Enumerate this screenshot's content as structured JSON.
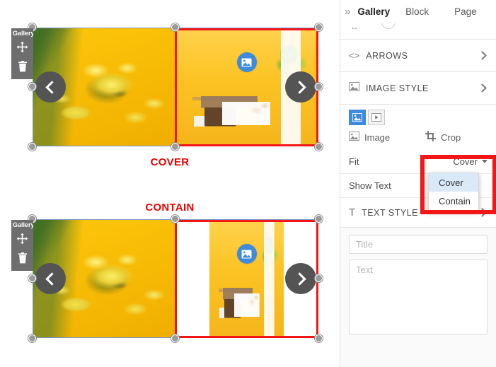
{
  "canvas": {
    "element_toolbar": {
      "title": "Gallery",
      "move_icon": "move-arrows-icon",
      "delete_icon": "trash-icon"
    },
    "galleries": [
      {
        "id": "cover-gallery",
        "caption": "COVER",
        "fit_mode": "cover",
        "slides": [
          {
            "name": "flower-photo",
            "alt": "yellow daffodils on yellow background"
          },
          {
            "name": "room-photo",
            "alt": "girl reclining on bench by yellow wall"
          }
        ],
        "prev_arrow": "chevron-left-icon",
        "next_arrow": "chevron-right-icon",
        "badge_icon": "image-badge-icon"
      },
      {
        "id": "contain-gallery",
        "caption": "CONTAIN",
        "fit_mode": "contain",
        "slides": [
          {
            "name": "flower-photo",
            "alt": "yellow daffodils on yellow background"
          },
          {
            "name": "room-photo",
            "alt": "girl reclining on bench by yellow wall"
          }
        ],
        "prev_arrow": "chevron-left-icon",
        "next_arrow": "chevron-right-icon",
        "badge_icon": "image-badge-icon"
      }
    ]
  },
  "panel": {
    "expand_icon": "double-chevron-right-icon",
    "tabs": [
      {
        "label": "Gallery",
        "active": true
      },
      {
        "label": "Block",
        "active": false
      },
      {
        "label": "Page",
        "active": false
      }
    ],
    "subbar": {
      "resize_icon": "horizontal-arrows-icon",
      "arc_icon": "arc-icon"
    },
    "sections": [
      {
        "name": "arrows",
        "icon": "code-brackets-icon",
        "label": "ARROWS",
        "chevron": "chevron-right-icon"
      },
      {
        "name": "image-style",
        "icon": "image-icon",
        "label": "IMAGE STYLE",
        "chevron": "chevron-right-icon"
      }
    ],
    "media_toggles": [
      {
        "name": "image-toggle",
        "icon": "image-icon",
        "selected": true
      },
      {
        "name": "video-toggle",
        "icon": "play-icon",
        "selected": false
      }
    ],
    "media_tabs": [
      {
        "name": "image-tab",
        "icon": "image-icon",
        "label": "Image"
      },
      {
        "name": "crop-tab",
        "icon": "crop-icon",
        "label": "Crop"
      }
    ],
    "fit": {
      "label": "Fit",
      "value": "Cover",
      "options": [
        {
          "label": "Cover",
          "selected": true
        },
        {
          "label": "Contain",
          "selected": false
        }
      ]
    },
    "show_text": {
      "label": "Show Text"
    },
    "text_style": {
      "icon": "text-T-icon",
      "label": "TEXT STYLE",
      "chevron": "chevron-right-icon"
    },
    "title_input": {
      "placeholder": "Title",
      "value": ""
    },
    "text_input": {
      "placeholder": "Text",
      "value": ""
    }
  },
  "colors": {
    "accent_blue": "#3d8ade",
    "highlight_red": "#f21616",
    "caption_red": "#f00000",
    "dropdown_selected": "#d9e9f8",
    "panel_bg": "#fafafa",
    "toolbar_gray": "#6e6e6e",
    "arrow_gray": "#545454"
  }
}
